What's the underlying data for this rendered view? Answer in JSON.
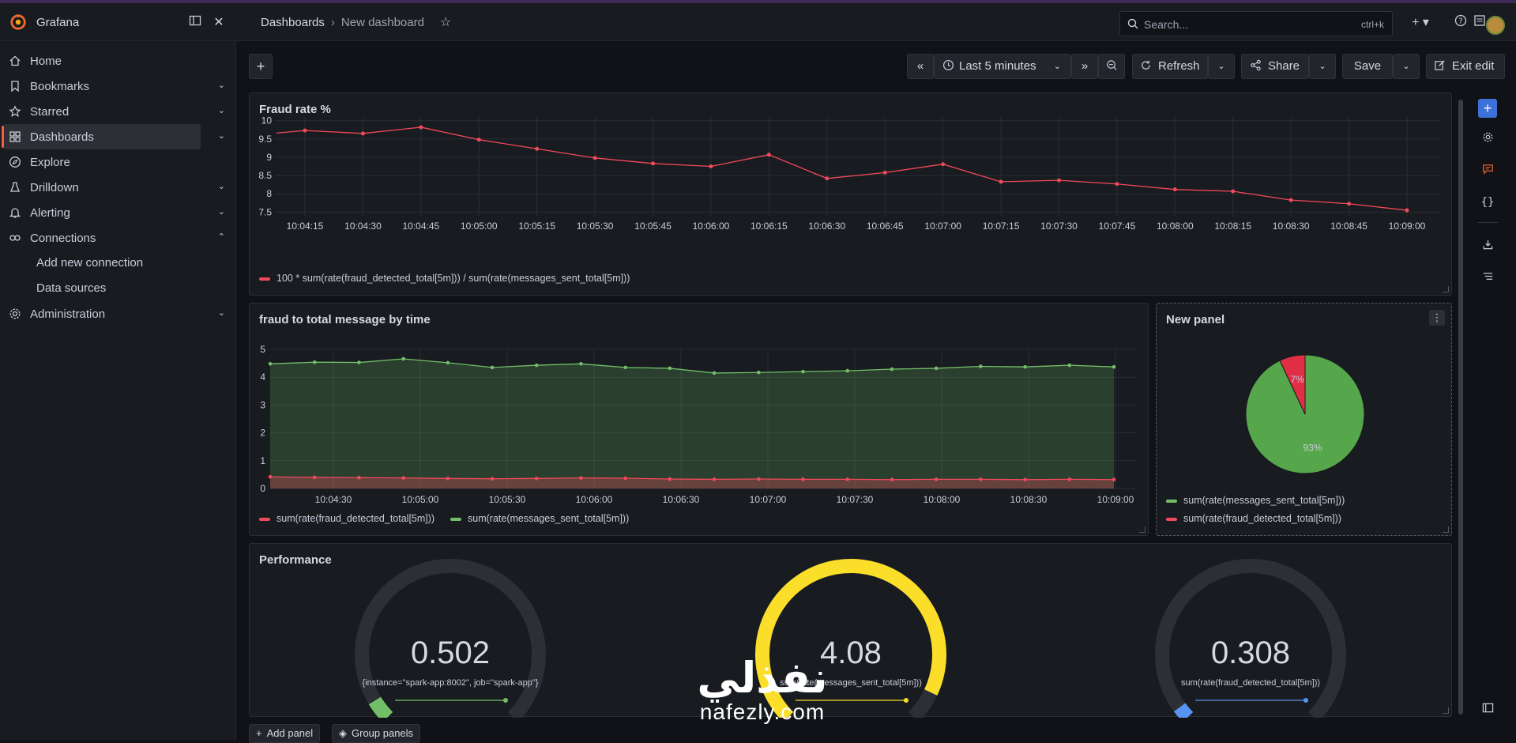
{
  "app": {
    "brand": "Grafana"
  },
  "breadcrumb": {
    "root": "Dashboards",
    "current": "New dashboard"
  },
  "search": {
    "placeholder": "Search...",
    "shortcut": "ctrl+k"
  },
  "sidebar": {
    "items": [
      {
        "label": "Home",
        "icon": "home-icon"
      },
      {
        "label": "Bookmarks",
        "icon": "bookmark-icon"
      },
      {
        "label": "Starred",
        "icon": "star-icon"
      },
      {
        "label": "Dashboards",
        "icon": "dashboards-icon"
      },
      {
        "label": "Explore",
        "icon": "compass-icon"
      },
      {
        "label": "Drilldown",
        "icon": "drilldown-icon"
      },
      {
        "label": "Alerting",
        "icon": "bell-icon"
      },
      {
        "label": "Connections",
        "icon": "connections-icon"
      },
      {
        "label": "Administration",
        "icon": "gear-icon"
      }
    ],
    "sub_items": [
      "Add new connection",
      "Data sources"
    ]
  },
  "toolbar": {
    "time_range": "Last 5 minutes",
    "refresh": "Refresh",
    "share": "Share",
    "save": "Save",
    "exit_edit": "Exit edit"
  },
  "bottom": {
    "add_panel": "Add panel",
    "group_panels": "Group panels"
  },
  "watermark": {
    "arabic": "نفذلي",
    "latin": "nafezly.com"
  },
  "colors": {
    "red": "#f2495c",
    "green": "#73bf69",
    "accent": "#3d71d9"
  },
  "chart_data": [
    {
      "type": "line",
      "title": "Fraud rate %",
      "x": [
        "10:04:15",
        "10:04:30",
        "10:04:45",
        "10:05:00",
        "10:05:15",
        "10:05:30",
        "10:05:45",
        "10:06:00",
        "10:06:15",
        "10:06:30",
        "10:06:45",
        "10:07:00",
        "10:07:15",
        "10:07:30",
        "10:07:45",
        "10:08:00",
        "10:08:15",
        "10:08:30",
        "10:08:45",
        "10:09:00"
      ],
      "yticks": [
        "10",
        "9.5",
        "9",
        "8.5",
        "8",
        "7.5"
      ],
      "ylim": [
        7.4,
        10.1
      ],
      "series": [
        {
          "name": "100 * sum(rate(fraud_detected_total[5m])) / sum(rate(messages_sent_total[5m]))",
          "color": "#f2495c",
          "values": [
            9.73,
            9.65,
            9.82,
            9.48,
            9.23,
            8.98,
            8.83,
            8.75,
            9.07,
            8.42,
            8.58,
            8.81,
            8.33,
            8.37,
            8.27,
            8.12,
            8.07,
            7.83,
            7.73,
            7.55
          ]
        }
      ],
      "legend": "bottom"
    },
    {
      "type": "area",
      "title": "fraud to total message by time",
      "xticks": [
        "10:04:30",
        "10:05:00",
        "10:05:30",
        "10:06:00",
        "10:06:30",
        "10:07:00",
        "10:07:30",
        "10:08:00",
        "10:08:30",
        "10:09:00"
      ],
      "yticks": [
        "5",
        "4",
        "3",
        "2",
        "1",
        "0"
      ],
      "ylim": [
        0,
        5
      ],
      "series": [
        {
          "name": "sum(rate(fraud_detected_total[5m]))",
          "color": "#f2495c",
          "values": [
            0.42,
            0.4,
            0.39,
            0.38,
            0.36,
            0.35,
            0.36,
            0.38,
            0.37,
            0.34,
            0.33,
            0.34,
            0.33,
            0.33,
            0.32,
            0.33,
            0.33,
            0.32,
            0.33,
            0.32
          ]
        },
        {
          "name": "sum(rate(messages_sent_total[5m]))",
          "color": "#73bf69",
          "values": [
            4.48,
            4.54,
            4.53,
            4.66,
            4.52,
            4.35,
            4.43,
            4.48,
            4.35,
            4.32,
            4.15,
            4.17,
            4.2,
            4.23,
            4.29,
            4.32,
            4.39,
            4.37,
            4.43,
            4.37
          ]
        }
      ],
      "legend": "bottom"
    },
    {
      "type": "pie",
      "title": "New panel",
      "slices": [
        {
          "name": "sum(rate(messages_sent_total[5m]))",
          "value": 93,
          "label": "93%",
          "color": "#56a64b"
        },
        {
          "name": "sum(rate(fraud_detected_total[5m]))",
          "value": 7,
          "label": "7%",
          "color": "#e02f44"
        }
      ],
      "legend": "bottom"
    },
    {
      "type": "gauge",
      "title": "Performance",
      "gauges": [
        {
          "value": "0.502",
          "numeric": 0.502,
          "max": 10,
          "color": "#73bf69",
          "subtitle": "{instance=\"spark-app:8002\", job=\"spark-app\"}"
        },
        {
          "value": "4.08",
          "numeric": 4.08,
          "max": 4.4,
          "color": "#fade2a",
          "subtitle": "sum(rate(messages_sent_total[5m]))"
        },
        {
          "value": "0.308",
          "numeric": 0.308,
          "max": 10,
          "color": "#5794f2",
          "subtitle": "sum(rate(fraud_detected_total[5m]))"
        }
      ]
    }
  ]
}
